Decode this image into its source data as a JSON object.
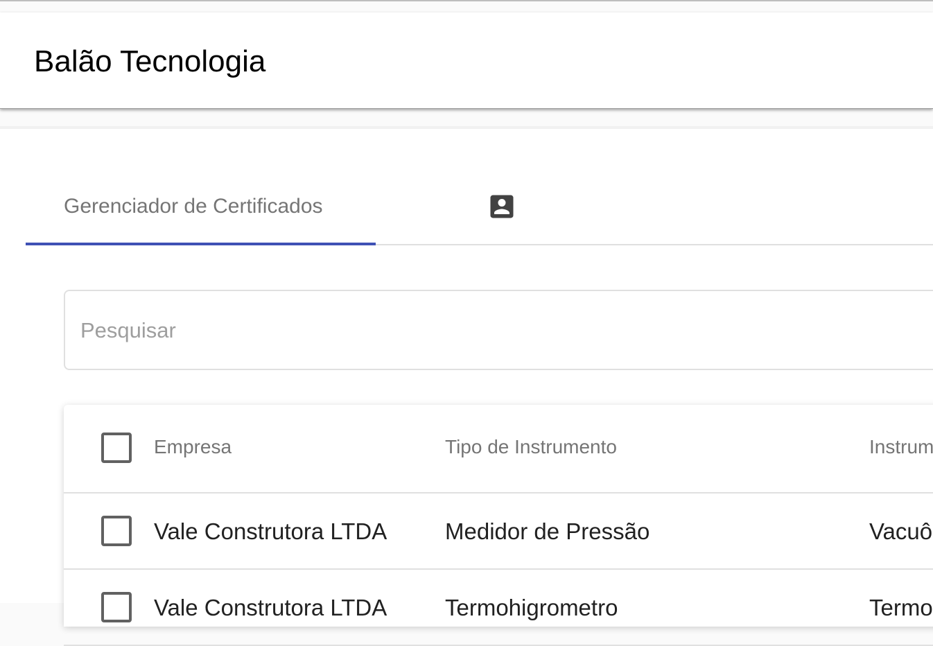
{
  "app": {
    "title": "Balão Tecnologia"
  },
  "tabs": [
    {
      "label": "Gerenciador de Certificados",
      "active": true
    },
    {
      "icon": "account-box-icon",
      "active": false
    }
  ],
  "search": {
    "placeholder": "Pesquisar",
    "value": ""
  },
  "table": {
    "columns": [
      "Empresa",
      "Tipo de Instrumento",
      "Instrume"
    ],
    "rows": [
      {
        "empresa": "Vale Construtora LTDA",
        "tipo": "Medidor de Pressão",
        "instrumento": "Vacuôn"
      },
      {
        "empresa": "Vale Construtora LTDA",
        "tipo": "Termohigrometro",
        "instrumento": "Termoh"
      }
    ]
  },
  "colors": {
    "accent": "#3f51b5",
    "appBar": "#ffffff",
    "muted": "#757575"
  }
}
